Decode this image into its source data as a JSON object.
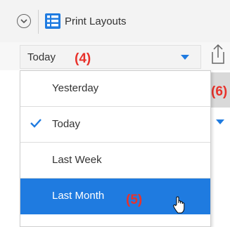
{
  "header": {
    "title": "Print Layouts",
    "collapse_icon": "chevron-down-circle-icon",
    "layouts_icon": "layouts-grid-icon"
  },
  "date_filter": {
    "value": "Today",
    "options": [
      {
        "label": "Yesterday",
        "checked": false,
        "hovered": false
      },
      {
        "label": "Today",
        "checked": true,
        "hovered": false
      },
      {
        "label": "Last Week",
        "checked": false,
        "hovered": false
      },
      {
        "label": "Last Month",
        "checked": false,
        "hovered": true
      }
    ]
  },
  "annotations": {
    "a4": "(4)",
    "a5": "(5)",
    "a6": "(6)"
  },
  "colors": {
    "accent": "#1f7be0",
    "annotation": "#e8322b"
  }
}
